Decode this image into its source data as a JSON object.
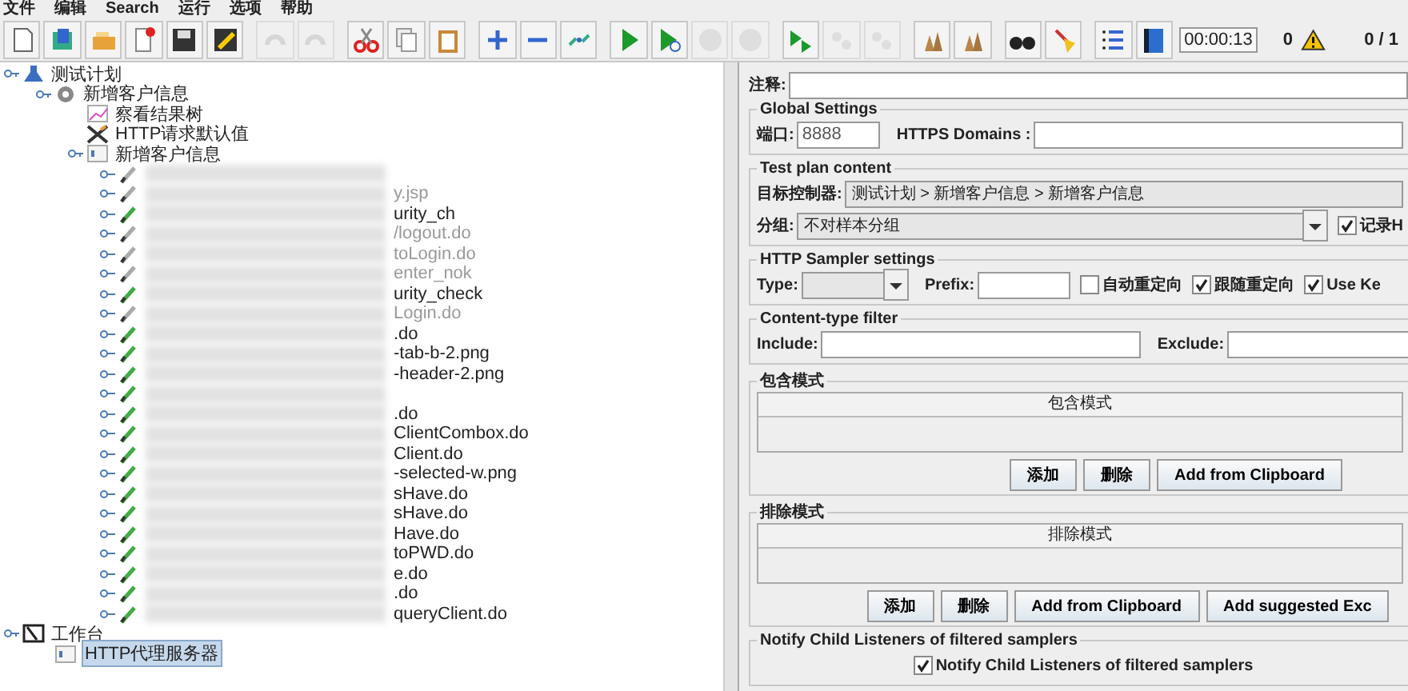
{
  "menu": [
    "文件",
    "编辑",
    "Search",
    "运行",
    "选项",
    "帮助"
  ],
  "toolbar": [
    {
      "kind": "new",
      "disabled": false
    },
    {
      "kind": "templates",
      "disabled": false
    },
    {
      "kind": "open",
      "disabled": false
    },
    {
      "kind": "close",
      "disabled": false
    },
    {
      "kind": "save",
      "disabled": false
    },
    {
      "kind": "saveas",
      "disabled": false
    },
    {
      "kind": "sep"
    },
    {
      "kind": "undo",
      "disabled": true
    },
    {
      "kind": "redo",
      "disabled": true
    },
    {
      "kind": "sep"
    },
    {
      "kind": "cut",
      "disabled": false
    },
    {
      "kind": "copy",
      "disabled": false
    },
    {
      "kind": "paste",
      "disabled": false
    },
    {
      "kind": "sep"
    },
    {
      "kind": "expand",
      "disabled": false
    },
    {
      "kind": "collapse",
      "disabled": false
    },
    {
      "kind": "toggle",
      "disabled": false
    },
    {
      "kind": "sep"
    },
    {
      "kind": "start",
      "disabled": false
    },
    {
      "kind": "startnp",
      "disabled": false
    },
    {
      "kind": "stop",
      "disabled": true
    },
    {
      "kind": "shutdown",
      "disabled": true
    },
    {
      "kind": "sep"
    },
    {
      "kind": "remote",
      "disabled": false
    },
    {
      "kind": "rstop",
      "disabled": true
    },
    {
      "kind": "rshut",
      "disabled": true
    },
    {
      "kind": "sep"
    },
    {
      "kind": "clear",
      "disabled": false
    },
    {
      "kind": "clearall",
      "disabled": false
    },
    {
      "kind": "sep"
    },
    {
      "kind": "search",
      "disabled": false
    },
    {
      "kind": "broom",
      "disabled": false
    },
    {
      "kind": "sep"
    },
    {
      "kind": "list",
      "disabled": false
    },
    {
      "kind": "help",
      "disabled": false
    }
  ],
  "status": {
    "timer": "00:00:13",
    "warnings": "0",
    "threads": "0 / 1"
  },
  "tree": [
    {
      "kind": "plan",
      "label": "测试计划",
      "expanded": true,
      "selected": false,
      "children": [
        {
          "kind": "threadgroup",
          "label": "新增客户信息",
          "expanded": true,
          "selected": false,
          "children": [
            {
              "kind": "listener",
              "label": "察看结果树",
              "selected": false
            },
            {
              "kind": "config",
              "label": "HTTP请求默认值",
              "selected": false
            },
            {
              "kind": "controller",
              "label": "新增客户信息",
              "expanded": true,
              "selected": false,
              "children": [
                {
                  "kind": "sampler",
                  "redacted": true,
                  "enabled": false
                },
                {
                  "kind": "sampler",
                  "redacted": true,
                  "enabled": false,
                  "label": "y.jsp",
                  "selected": false
                },
                {
                  "kind": "sampler",
                  "redacted": true,
                  "enabled": true,
                  "label": "urity_ch",
                  "selected": false
                },
                {
                  "kind": "sampler",
                  "redacted": true,
                  "enabled": false,
                  "label": "/logout.do",
                  "selected": false
                },
                {
                  "kind": "sampler",
                  "redacted": true,
                  "enabled": false,
                  "label": "toLogin.do",
                  "selected": false
                },
                {
                  "kind": "sampler",
                  "redacted": true,
                  "enabled": false,
                  "label": "enter_nok",
                  "selected": false
                },
                {
                  "kind": "sampler",
                  "redacted": true,
                  "enabled": true,
                  "label": "urity_check",
                  "selected": false
                },
                {
                  "kind": "sampler",
                  "redacted": true,
                  "enabled": false,
                  "label": "Login.do",
                  "selected": false
                },
                {
                  "kind": "sampler",
                  "redacted": true,
                  "enabled": true,
                  "label": ".do",
                  "selected": false
                },
                {
                  "kind": "sampler",
                  "redacted": true,
                  "enabled": true,
                  "label": "-tab-b-2.png",
                  "selected": false
                },
                {
                  "kind": "sampler",
                  "redacted": true,
                  "enabled": true,
                  "label": "-header-2.png",
                  "selected": false
                },
                {
                  "kind": "sampler",
                  "redacted": true,
                  "enabled": true
                },
                {
                  "kind": "sampler",
                  "redacted": true,
                  "enabled": true,
                  "label": ".do",
                  "selected": false
                },
                {
                  "kind": "sampler",
                  "redacted": true,
                  "enabled": true,
                  "label": "ClientCombox.do",
                  "selected": false
                },
                {
                  "kind": "sampler",
                  "redacted": true,
                  "enabled": true,
                  "label": "Client.do",
                  "selected": false
                },
                {
                  "kind": "sampler",
                  "redacted": true,
                  "enabled": true,
                  "label": "-selected-w.png",
                  "selected": false
                },
                {
                  "kind": "sampler",
                  "redacted": true,
                  "enabled": true,
                  "label": "sHave.do",
                  "selected": false
                },
                {
                  "kind": "sampler",
                  "redacted": true,
                  "enabled": true,
                  "label": "sHave.do",
                  "selected": false
                },
                {
                  "kind": "sampler",
                  "redacted": true,
                  "enabled": true,
                  "label": "Have.do",
                  "selected": false
                },
                {
                  "kind": "sampler",
                  "redacted": true,
                  "enabled": true,
                  "label": "toPWD.do",
                  "selected": false
                },
                {
                  "kind": "sampler",
                  "redacted": true,
                  "enabled": true,
                  "label": "e.do",
                  "selected": false
                },
                {
                  "kind": "sampler",
                  "redacted": true,
                  "enabled": true,
                  "label": ".do",
                  "selected": false
                },
                {
                  "kind": "sampler",
                  "redacted": true,
                  "enabled": true,
                  "label": "queryClient.do",
                  "selected": false
                }
              ]
            }
          ]
        }
      ]
    },
    {
      "kind": "workbench",
      "label": "工作台",
      "expanded": true,
      "selected": false,
      "children": [
        {
          "kind": "proxy",
          "label": "HTTP代理服务器",
          "selected": true
        }
      ]
    }
  ],
  "form": {
    "comment_label": "注释:",
    "global": {
      "title": "Global Settings",
      "port_label": "端口:",
      "port": "8888",
      "domains_label": "HTTPS Domains :"
    },
    "plan": {
      "title": "Test plan content",
      "target_label": "目标控制器:",
      "target": "测试计划 > 新增客户信息 > 新增客户信息",
      "group_label": "分组:",
      "group": "不对样本分组",
      "record": {
        "label": "记录H",
        "checked": true
      }
    },
    "sampler": {
      "title": "HTTP Sampler settings",
      "type_label": "Type:",
      "prefix_label": "Prefix:",
      "checks": [
        {
          "label": "自动重定向",
          "checked": false
        },
        {
          "label": "跟随重定向",
          "checked": true
        },
        {
          "label": "Use Ke",
          "checked": true
        }
      ]
    },
    "ctype": {
      "title": "Content-type filter",
      "include_label": "Include:",
      "exclude_label": "Exclude:"
    },
    "include": {
      "title": "包含模式",
      "header": "包含模式",
      "buttons": [
        "添加",
        "删除",
        "Add from Clipboard"
      ]
    },
    "exclude": {
      "title": "排除模式",
      "header": "排除模式",
      "buttons": [
        "添加",
        "删除",
        "Add from Clipboard",
        "Add suggested Exc"
      ]
    },
    "notify": {
      "title": "Notify Child Listeners of filtered samplers",
      "label": "Notify Child Listeners of filtered samplers",
      "checked": true
    }
  }
}
